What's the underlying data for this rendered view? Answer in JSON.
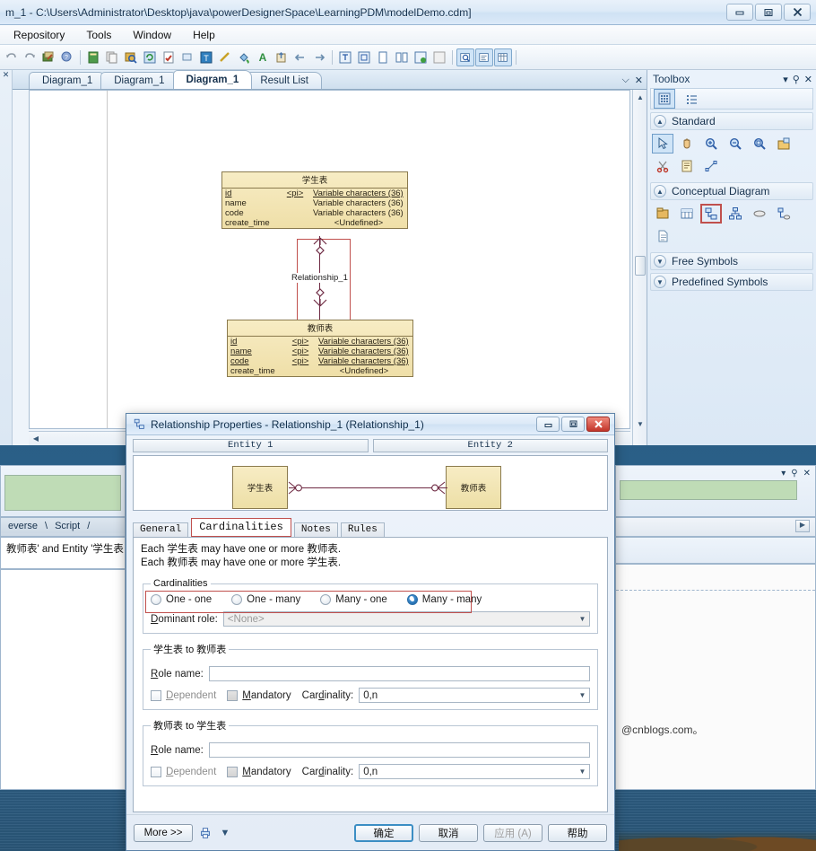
{
  "window": {
    "title": "m_1 - C:\\Users\\Administrator\\Desktop\\java\\powerDesignerSpace\\LearningPDM\\modelDemo.cdm]",
    "caption": {
      "minimize": "–",
      "maximize": "□",
      "close": "✕"
    }
  },
  "menubar": {
    "items": [
      "Repository",
      "Tools",
      "Window",
      "Help"
    ]
  },
  "toolbar": {
    "groups": [
      {
        "icons": [
          "undo-icon",
          "redo-icon",
          "edit-properties-icon",
          "help-pointer-icon"
        ]
      },
      {
        "icons": [
          "new-model-icon",
          "copy-icon",
          "find-icon",
          "refresh-icon",
          "check-model-icon",
          "rectangle-icon",
          "text-tool-icon",
          "line-icon",
          "fill-color-icon",
          "font-color-icon",
          "export-icon",
          "align-left-icon",
          "align-right-icon"
        ]
      },
      {
        "icons": [
          "zoom-page-icon",
          "zoom-fit-icon",
          "page-icon",
          "two-page-icon",
          "zoom-in-page-icon",
          "zoom-grid-icon"
        ]
      },
      {
        "icons": [
          "browser-icon",
          "output-icon",
          "result-list-icon"
        ]
      }
    ],
    "selected": [
      "browser-icon",
      "output-icon",
      "result-list-icon"
    ]
  },
  "diagram_tabs": {
    "tabs": [
      {
        "label": "Diagram_1",
        "active": false
      },
      {
        "label": "Diagram_1",
        "active": false
      },
      {
        "label": "Diagram_1",
        "active": true
      },
      {
        "label": "Result List",
        "active": false
      }
    ],
    "controls": {
      "dropdown": "⌵",
      "close": "✕"
    }
  },
  "canvas": {
    "entities": [
      {
        "name": "学生表",
        "attributes": [
          {
            "name": "id",
            "pi": "<pi>",
            "type": "Variable characters (36)",
            "underline": true
          },
          {
            "name": "name",
            "pi": "",
            "type": "Variable characters (36)",
            "underline": false
          },
          {
            "name": "code",
            "pi": "",
            "type": "Variable characters (36)",
            "underline": false
          },
          {
            "name": "create_time",
            "pi": "",
            "type": "<Undefined>",
            "underline": false
          }
        ]
      },
      {
        "name": "教师表",
        "attributes": [
          {
            "name": "id",
            "pi": "<pi>",
            "type": "Variable characters (36)",
            "underline": true
          },
          {
            "name": "name",
            "pi": "<pi>",
            "type": "Variable characters (36)",
            "underline": true
          },
          {
            "name": "code",
            "pi": "<pi>",
            "type": "Variable characters (36)",
            "underline": true
          },
          {
            "name": "create_time",
            "pi": "",
            "type": "<Undefined>",
            "underline": false
          }
        ]
      }
    ],
    "relationship_label": "Relationship_1"
  },
  "toolbox": {
    "title": "Toolbox",
    "header_icons": [
      "dropdown-icon",
      "pin-icon",
      "close-icon"
    ],
    "top_row_icons": [
      "grid-view-icon",
      "list-view-icon"
    ],
    "groups": [
      {
        "label": "Standard",
        "expanded": true,
        "icons": [
          "pointer-icon",
          "pan-hand-icon",
          "zoom-in-icon",
          "zoom-out-icon",
          "zoom-area-icon",
          "open-package-icon",
          "cut-icon",
          "note-icon",
          "link-icon"
        ],
        "selected": "pointer-icon"
      },
      {
        "label": "Conceptual Diagram",
        "expanded": true,
        "icons": [
          "package-icon",
          "entity-icon",
          "relationship-icon",
          "inheritance-icon",
          "association-icon",
          "association-link-icon",
          "file-icon"
        ],
        "selected": "relationship-icon"
      },
      {
        "label": "Free Symbols",
        "expanded": false,
        "icons": []
      },
      {
        "label": "Predefined Symbols",
        "expanded": false,
        "icons": []
      }
    ]
  },
  "bottom_panels": {
    "left": {
      "tabs": [
        "everse",
        "Script"
      ],
      "message": "教师表' and Entity '学生表"
    },
    "right": {
      "header_icons": [
        "dropdown-icon",
        "pin-icon",
        "close-icon"
      ]
    },
    "watermark": "@cnblogs.com。"
  },
  "dialog": {
    "title": "Relationship Properties - Relationship_1 (Relationship_1)",
    "icon": "relationship-icon",
    "caption": {
      "minimize": "–",
      "maximize": "□",
      "close": "✕"
    },
    "entity_tabs": [
      {
        "label": "Entity 1"
      },
      {
        "label": "Entity 2"
      }
    ],
    "preview": {
      "entity1": "学生表",
      "entity2": "教师表"
    },
    "tabs": [
      {
        "label": "General",
        "active": false
      },
      {
        "label": "Cardinalities",
        "active": true
      },
      {
        "label": "Notes",
        "active": false
      },
      {
        "label": "Rules",
        "active": false
      }
    ],
    "sentences": [
      "Each 学生表 may have one or more 教师表.",
      "Each 教师表 may have one or more 学生表."
    ],
    "cardinalities": {
      "legend": "Cardinalities",
      "options": [
        {
          "label": "One - one",
          "selected": false
        },
        {
          "label": "One - many",
          "selected": false
        },
        {
          "label": "Many - one",
          "selected": false
        },
        {
          "label": "Many - many",
          "selected": true
        }
      ],
      "dominant_role": {
        "label": "Dominant role:",
        "value": "<None>",
        "disabled": true
      }
    },
    "role_a": {
      "legend": "学生表 to 教师表",
      "role_name_label": "Role name:",
      "role_name_value": "",
      "dependent_label": "Dependent",
      "dependent_checked": false,
      "mandatory_label": "Mandatory",
      "mandatory_checked": false,
      "cardinality_label": "Cardinality:",
      "cardinality_value": "0,n"
    },
    "role_b": {
      "legend": "教师表 to 学生表",
      "role_name_label": "Role name:",
      "role_name_value": "",
      "dependent_label": "Dependent",
      "dependent_checked": false,
      "mandatory_label": "Mandatory",
      "mandatory_checked": false,
      "cardinality_label": "Cardinality:",
      "cardinality_value": "0,n"
    },
    "footer": {
      "more": "More >>",
      "print_icon": "print-icon",
      "dropdown_icon": "chevron-down-icon",
      "ok": "确定",
      "cancel": "取消",
      "apply": "应用 (A)",
      "help": "帮助"
    }
  },
  "colors": {
    "accent": "#3b8ec4",
    "entity_fill": "#f2e4b4",
    "relationship_line": "#6f2b44",
    "highlight_red": "#c0504d",
    "selection_blue": "#cfe4f7",
    "green_bar": "#bfdcb6"
  }
}
